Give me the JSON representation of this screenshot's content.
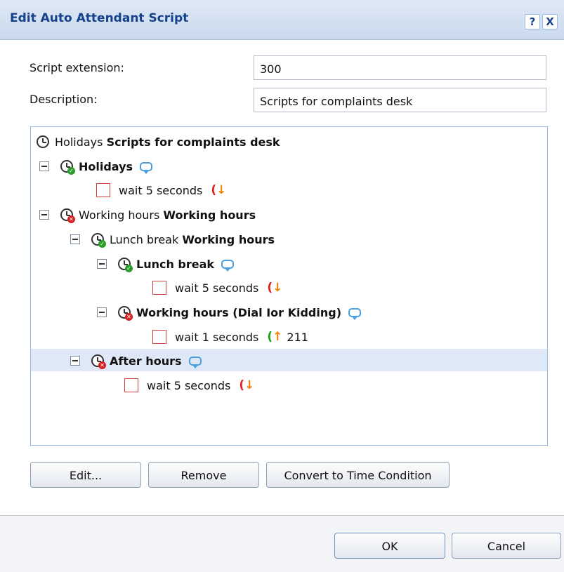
{
  "dialog": {
    "title": "Edit Auto Attendant Script",
    "help_label": "?",
    "close_label": "X"
  },
  "form": {
    "extension_label": "Script extension:",
    "extension_value": "300",
    "description_label": "Description:",
    "description_value": "Scripts for complaints desk"
  },
  "tree": {
    "root": {
      "prefix": "Holidays",
      "title": "Scripts for complaints desk"
    },
    "holidays": {
      "title": "Holidays",
      "action": "wait 5 seconds"
    },
    "working": {
      "prefix": "Working hours",
      "title": "Working hours"
    },
    "lunch_group": {
      "prefix": "Lunch break",
      "title": "Working hours"
    },
    "lunch": {
      "title": "Lunch break",
      "action": "wait 5 seconds"
    },
    "dial": {
      "title": "Working hours (Dial Ior Kidding)",
      "action": "wait 1 seconds",
      "number": "211"
    },
    "after": {
      "title": "After hours",
      "action": "wait 5 seconds"
    }
  },
  "buttons": {
    "edit": "Edit...",
    "remove": "Remove",
    "convert": "Convert to Time Condition",
    "ok": "OK",
    "cancel": "Cancel"
  },
  "colors": {
    "title_text": "#15428b",
    "selection": "#dfe8f6",
    "hangup": "#e02020",
    "forward": "#18a018",
    "comment": "#49a0e0"
  }
}
